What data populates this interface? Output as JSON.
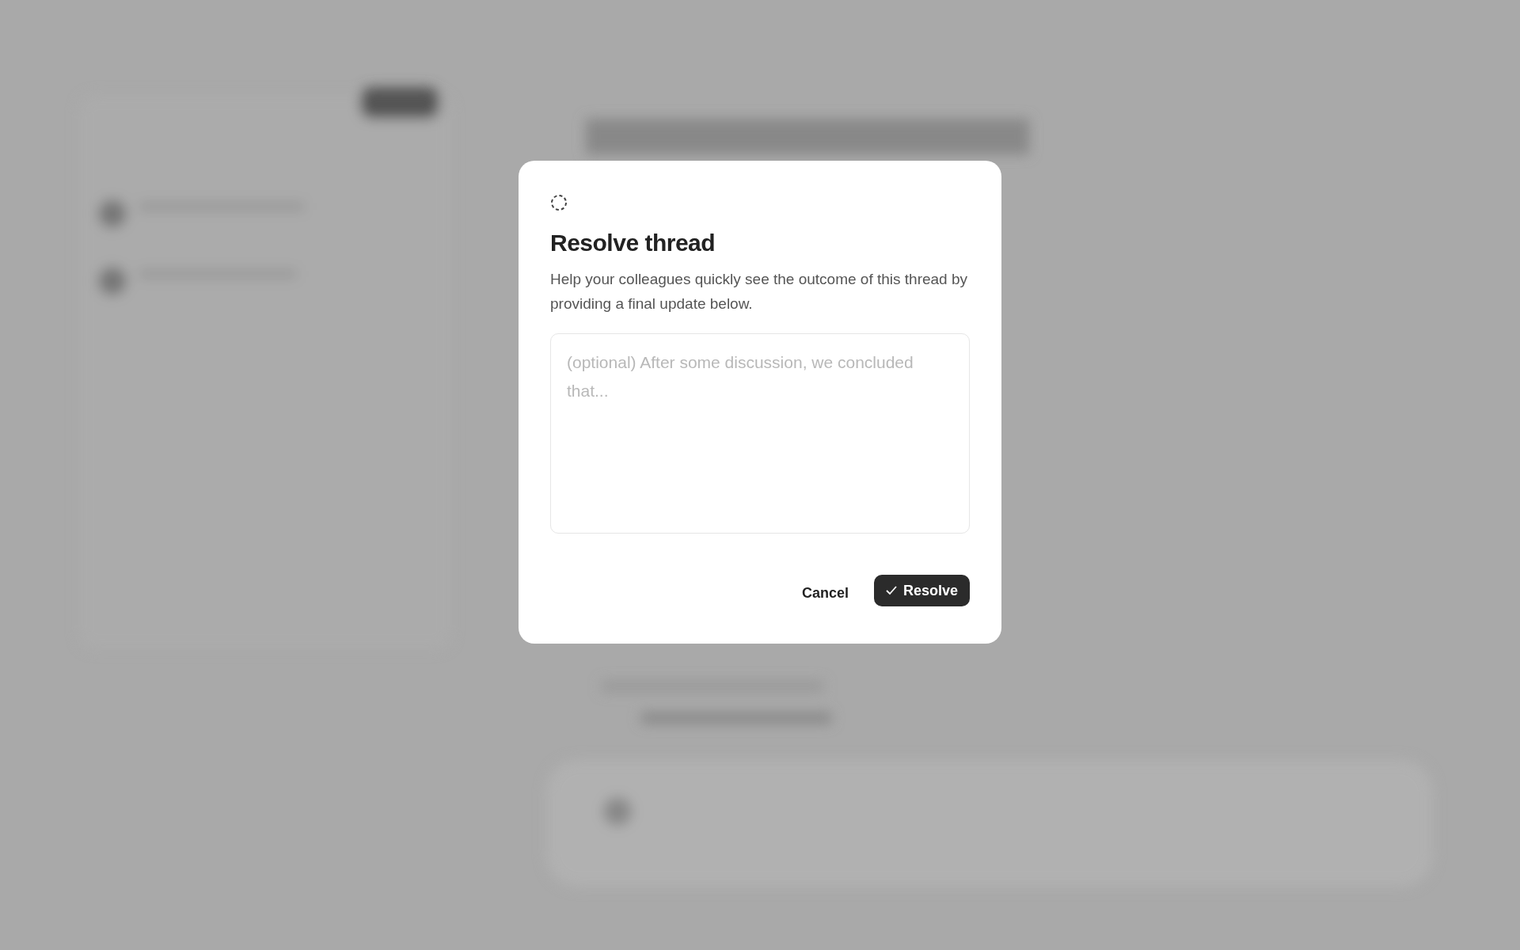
{
  "dialog": {
    "title": "Resolve thread",
    "description": "Help your colleagues quickly see the outcome of this thread by providing a final update below.",
    "field": {
      "placeholder": "(optional) After some discussion, we concluded that..."
    },
    "buttons": [
      {
        "label": "Cancel",
        "kind": "secondary"
      },
      {
        "label": "Resolve",
        "kind": "primary"
      }
    ]
  }
}
